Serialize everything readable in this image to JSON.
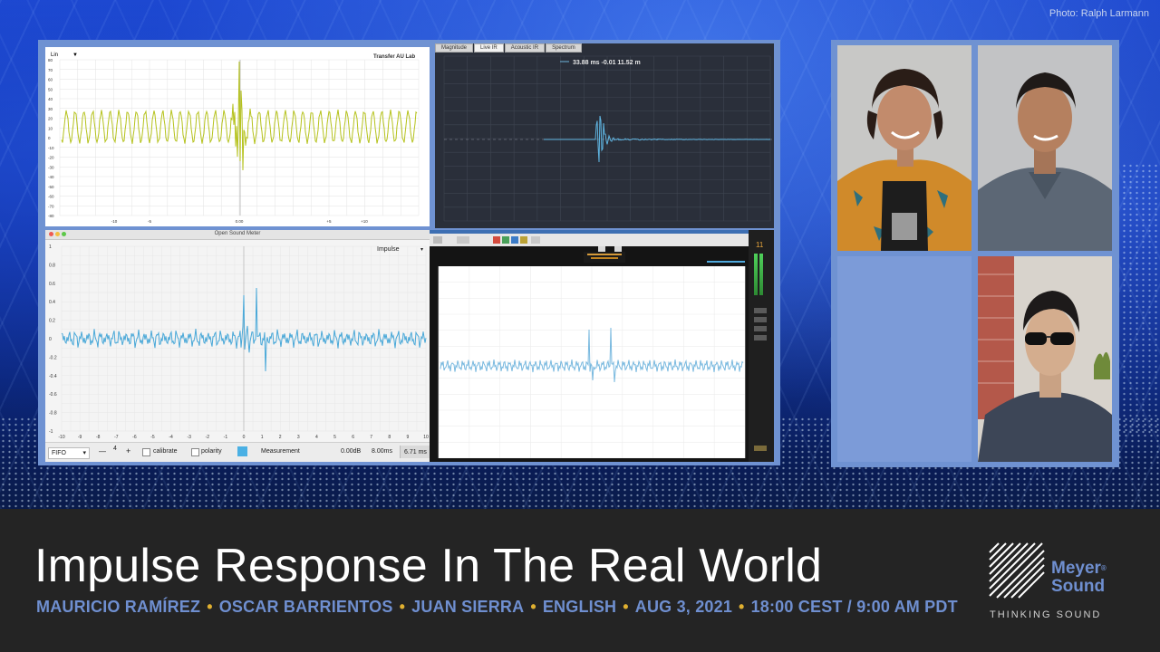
{
  "photo_credit": "Photo: Ralph Larmann",
  "title": "Impulse Response In The Real World",
  "presenters": [
    "MAURICIO RAMÍREZ",
    "OSCAR BARRIENTOS",
    "JUAN SIERRA",
    "ENGLISH",
    "AUG 3, 2021",
    "18:00 CEST / 9:00 AM PDT"
  ],
  "logo": {
    "line1": "Meyer",
    "line2": "Sound",
    "reg": "®",
    "tagline": "THINKING SOUND"
  },
  "colors": {
    "accent_blue": "#6f8fd0",
    "separator": "#e0b030",
    "panel_frame": "#6f92d2"
  },
  "windows": {
    "top_left": {
      "label": "Lin",
      "title": "Transfer AU Lab",
      "y_ticks": [
        "80",
        "70",
        "60",
        "50",
        "40",
        "30",
        "20",
        "10",
        "0",
        "-10",
        "-20",
        "-30",
        "-40",
        "-50",
        "-60",
        "-70",
        "-80"
      ],
      "x_ticks": [
        "-10",
        "-5",
        "0.00",
        "+5",
        "+10"
      ]
    },
    "top_right": {
      "tabs": [
        "Magnitude",
        "Live IR",
        "Acoustic IR",
        "Spectrum"
      ],
      "active_tab": "Live IR",
      "readout": "33.88 ms  -0.01  11.52 m"
    },
    "bottom_left": {
      "window_title": "Open Sound Meter",
      "mode": "Impulse",
      "y_ticks": [
        "1",
        "0.8",
        "0.6",
        "0.4",
        "0.2",
        "0",
        "-0.2",
        "-0.4",
        "-0.6",
        "-0.8",
        "-1"
      ],
      "x_ticks": [
        "-10",
        "-9",
        "-8",
        "-7",
        "-6",
        "-5",
        "-4",
        "-3",
        "-2",
        "-1",
        "0",
        "1",
        "2",
        "3",
        "4",
        "5",
        "6",
        "7",
        "8",
        "9",
        "10"
      ],
      "toolbar": {
        "fifo": "FIFO",
        "minus": "—",
        "count": "4",
        "plus": "+",
        "calibrate": "calibrate",
        "polarity": "polarity",
        "measurement": "Measurement",
        "gain": "0.00dB",
        "delay": "8.00ms",
        "time": "6.71 ms"
      }
    },
    "bottom_right": {
      "level": "11"
    }
  }
}
